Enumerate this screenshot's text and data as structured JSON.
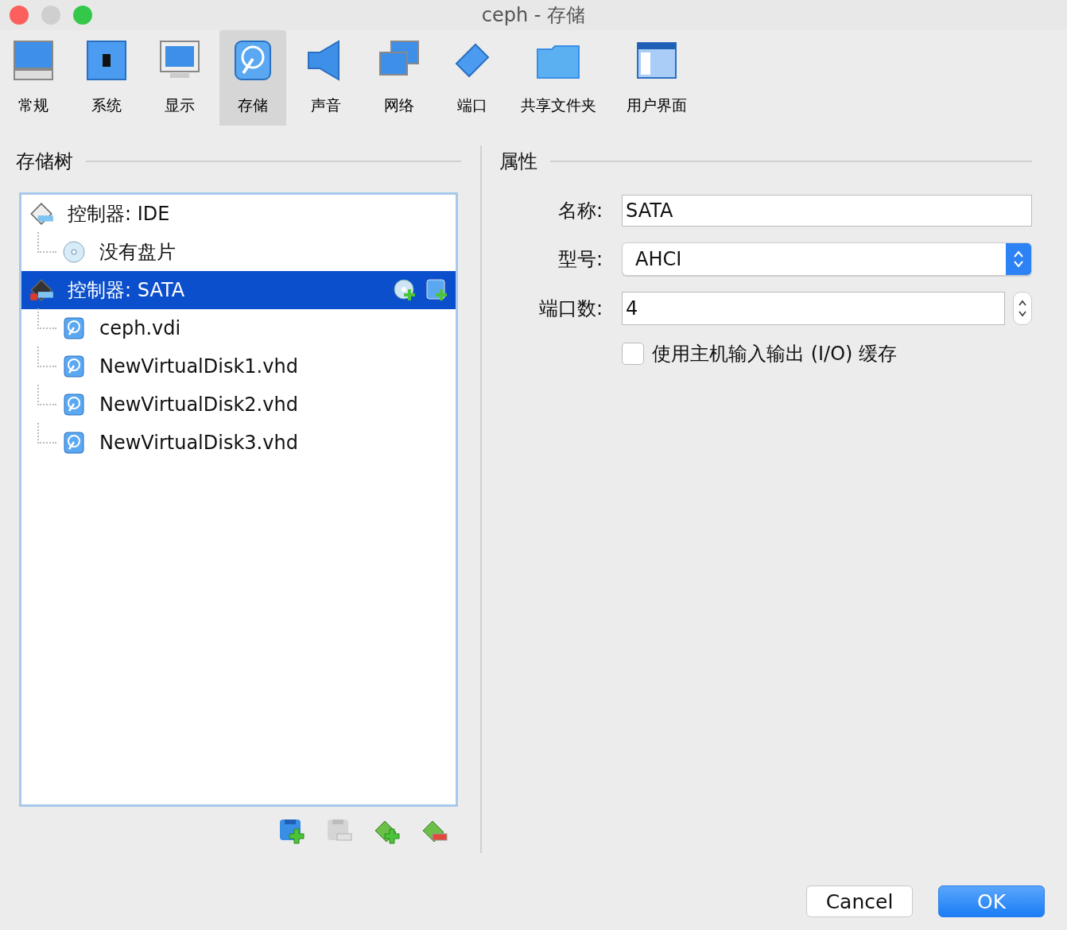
{
  "window": {
    "title": "ceph - 存储"
  },
  "toolbar": [
    {
      "label": "常规",
      "selected": false
    },
    {
      "label": "系统",
      "selected": false
    },
    {
      "label": "显示",
      "selected": false
    },
    {
      "label": "存储",
      "selected": true
    },
    {
      "label": "声音",
      "selected": false
    },
    {
      "label": "网络",
      "selected": false
    },
    {
      "label": "端口",
      "selected": false
    },
    {
      "label": "共享文件夹",
      "selected": false
    },
    {
      "label": "用户界面",
      "selected": false
    }
  ],
  "storage_tree": {
    "title": "存储树",
    "items": [
      {
        "kind": "ide",
        "label": "控制器: IDE",
        "selected": false,
        "children": [
          {
            "kind": "optical",
            "label": "没有盘片",
            "selected": false
          }
        ]
      },
      {
        "kind": "sata",
        "label": "控制器: SATA",
        "selected": true,
        "children": [
          {
            "kind": "disk",
            "label": "ceph.vdi",
            "selected": false
          },
          {
            "kind": "disk",
            "label": "NewVirtualDisk1.vhd",
            "selected": false
          },
          {
            "kind": "disk",
            "label": "NewVirtualDisk2.vhd",
            "selected": false
          },
          {
            "kind": "disk",
            "label": "NewVirtualDisk3.vhd",
            "selected": false
          }
        ]
      }
    ],
    "actions": [
      {
        "kind": "add-controller",
        "disabled": false
      },
      {
        "kind": "remove-controller",
        "disabled": true
      },
      {
        "kind": "add-attachment",
        "disabled": false
      },
      {
        "kind": "remove-attachment",
        "disabled": false
      }
    ]
  },
  "attributes": {
    "title": "属性",
    "name_label": "名称:",
    "name_value": "SATA",
    "type_label": "型号:",
    "type_value": "AHCI",
    "ports_label": "端口数:",
    "ports_value": "4",
    "io_cache_label": "使用主机输入输出 (I/O) 缓存",
    "io_cache_checked": false
  },
  "buttons": {
    "cancel": "Cancel",
    "ok": "OK"
  }
}
